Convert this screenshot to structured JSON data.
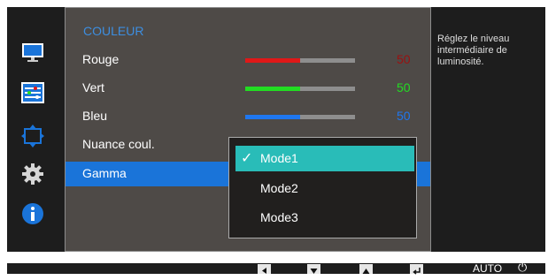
{
  "icons": [
    "monitor-icon",
    "color-adjust-icon",
    "resize-icon",
    "settings-gear-icon",
    "information-icon"
  ],
  "menu": {
    "section_title": "COULEUR",
    "rows": [
      {
        "label": "Rouge",
        "value": "50",
        "level": 0.5,
        "color": "#e01818"
      },
      {
        "label": "Vert",
        "value": "50",
        "level": 0.5,
        "color": "#22dd22"
      },
      {
        "label": "Bleu",
        "value": "50",
        "level": 0.5,
        "color": "#1f77f0"
      },
      {
        "label": "Nuance coul."
      },
      {
        "label": "Gamma"
      }
    ]
  },
  "gamma_dropdown": {
    "options": [
      "Mode1",
      "Mode2",
      "Mode3"
    ],
    "selected": "Mode1",
    "check_glyph": "✓"
  },
  "info_text": "Réglez le niveau intermédiaire de luminosité.",
  "bottom_bar": {
    "buttons": [
      "left-arrow-icon",
      "down-arrow-icon",
      "up-arrow-icon",
      "enter-icon"
    ],
    "auto_label": "AUTO",
    "power_glyph": "⏻"
  },
  "colors": {
    "selection_blue": "#1a74d9",
    "dropdown_teal": "#29bcb8",
    "title_blue": "#3d8ee0",
    "red_value": "#9b1010",
    "green_value": "#22dd22",
    "blue_value": "#1f77f0"
  }
}
